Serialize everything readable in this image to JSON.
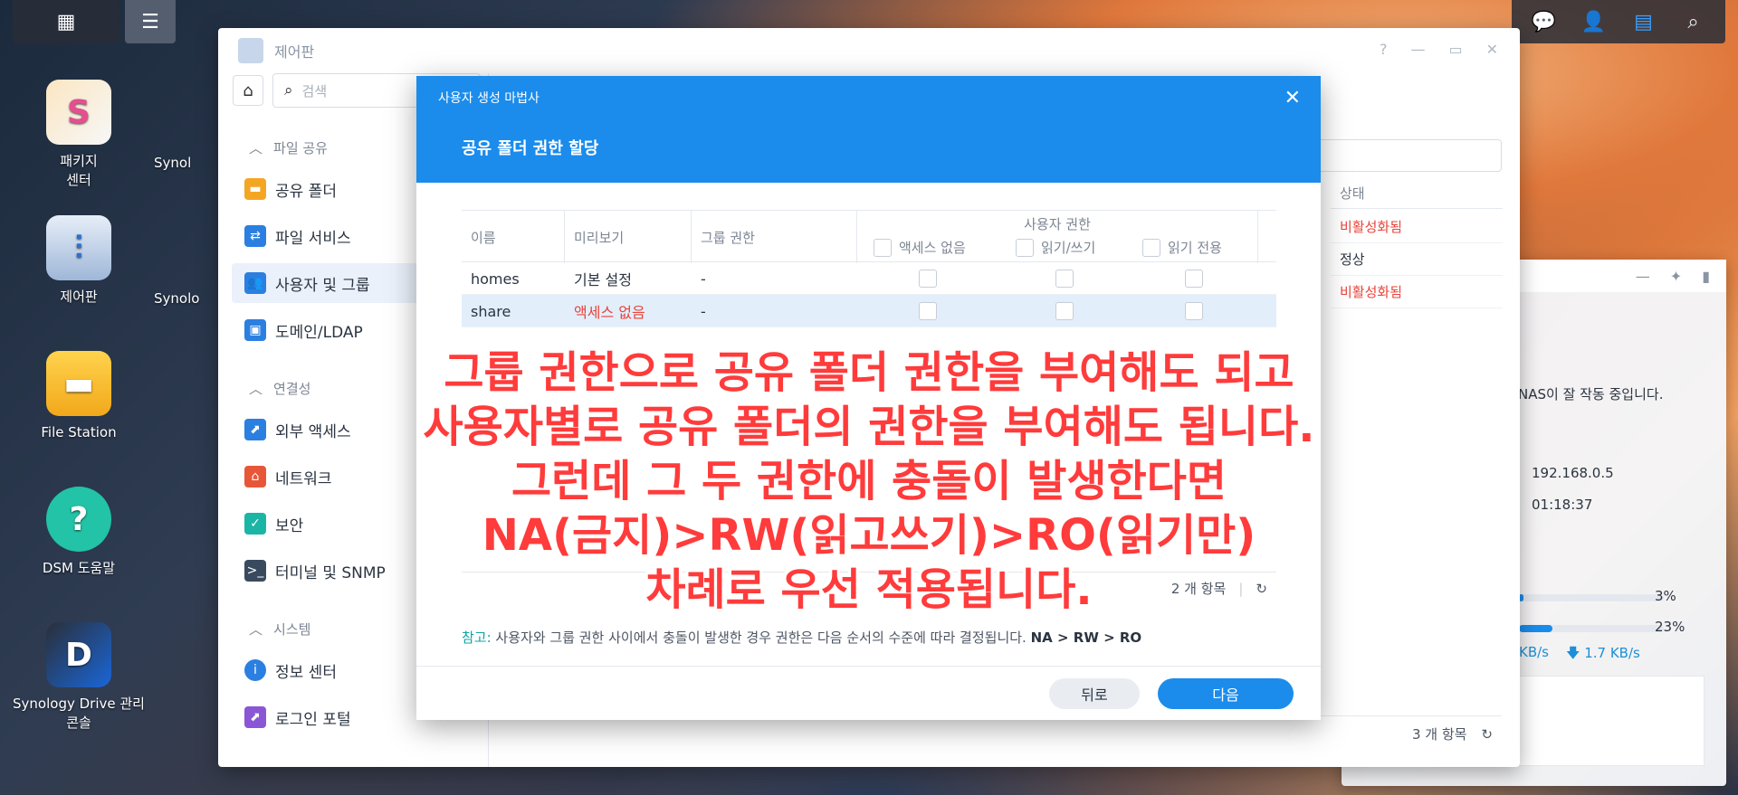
{
  "desktop": {
    "icons": [
      {
        "label": "패키지\n센터",
        "icon": "package-icon"
      },
      {
        "label": "제어판",
        "icon": "control-panel-icon"
      },
      {
        "label": "File Station",
        "icon": "folder-icon"
      },
      {
        "label": "DSM 도움말",
        "icon": "help-icon"
      },
      {
        "label": "Synology Drive 관리\n콘솔",
        "icon": "drive-icon"
      }
    ],
    "partial_labels": [
      "Synol",
      "Synolo"
    ]
  },
  "control_panel": {
    "title": "제어판",
    "search_placeholder": "검색",
    "sections": {
      "file_sharing": "파일 공유",
      "connectivity": "연결성",
      "system": "시스템"
    },
    "items": {
      "shared_folder": "공유 폴더",
      "file_services": "파일 서비스",
      "user_group": "사용자 및 그룹",
      "domain_ldap": "도메인/LDAP",
      "external_access": "외부 액세스",
      "network": "네트워크",
      "security": "보안",
      "terminal_snmp": "터미널 및 SNMP",
      "info_center": "정보 센터",
      "login_portal": "로그인 포털"
    },
    "status_header": "상태",
    "status_rows": [
      "비활성화됨",
      "정상",
      "비활성화됨"
    ],
    "footer_count": "3 개 항목"
  },
  "widget": {
    "status_text": "NAS이 잘 작동 중입니다.",
    "ip": "192.168.0.5",
    "uptime": "01:18:37",
    "cpu_pct": "3%",
    "ram_pct": "23%",
    "upload": "KB/s",
    "download": "1.7 KB/s",
    "cpu_fraction": 0.03,
    "ram_fraction": 0.23
  },
  "wizard": {
    "subtitle": "사용자 생성 마법사",
    "title": "공유 폴더 권한 할당",
    "columns": {
      "name": "이름",
      "preview": "미리보기",
      "group_perm": "그룹 권한",
      "user_perm": "사용자 권한",
      "no_access": "액세스 없음",
      "read_write": "읽기/쓰기",
      "read_only": "읽기 전용"
    },
    "rows": [
      {
        "name": "homes",
        "preview": "기본 설정",
        "group": "-"
      },
      {
        "name": "share",
        "preview": "액세스 없음",
        "group": "-"
      }
    ],
    "count": "2 개 항목",
    "note_label": "참고:",
    "note_text": " 사용자와 그룹 권한 사이에서 충돌이 발생한 경우 권한은 다음 순서의 수준에 따라 결정됩니다. ",
    "note_order": "NA > RW > RO",
    "back": "뒤로",
    "next": "다음"
  },
  "caption": {
    "line1": "그룹 권한으로 공유 폴더 권한을 부여해도 되고",
    "line2": "사용자별로 공유 폴더의 권한을 부여해도 됩니다.",
    "line3": "그런데 그 두 권한에 충돌이 발생한다면",
    "line4": "NA(금지)>RW(읽고쓰기)>RO(읽기만)",
    "line5": "차례로 우선 적용됩니다."
  },
  "colors": {
    "accent": "#1b8cec",
    "danger": "#e8443a",
    "caption": "#ff3b3b"
  }
}
